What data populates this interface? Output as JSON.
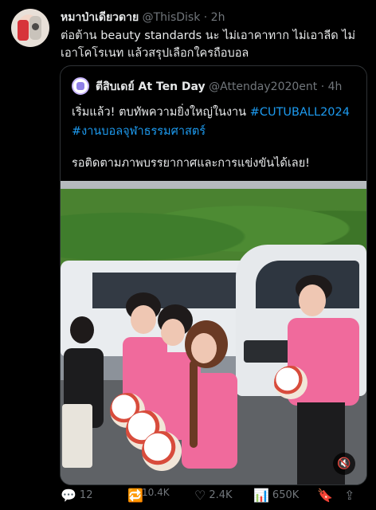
{
  "tweet": {
    "author_name": "หมาป่าเดียวดาย",
    "handle": "@ThisDisk",
    "separator": "·",
    "time": "2h",
    "text_line1": "ต่อต้าน beauty standards นะ ไม่เอาคาทาก ไม่เอาลีด ไม่",
    "text_line2": "เอาโคโรเนท แล้วสรุปเลือกใครถือบอล"
  },
  "quote": {
    "author_name": "ตีสิบเดย์ At Ten Day",
    "handle": "@Attenday2020ent",
    "separator": "·",
    "time": "4h",
    "line1_text": "เริ่มแล้ว! ตบทัพความยิ่งใหญ่ในงาน ",
    "line1_hashtag": "#CUTUBALL2024",
    "line2_hashtag": "#งานบอลจุฬาธรรมศาสตร์",
    "line3_text": "รอติดตามภาพบรรยากาศและการแข่งขันได้เลย!"
  },
  "media": {
    "mute_icon": "speaker-muted-icon",
    "mute_glyph": "🔇"
  },
  "actions": {
    "reply_icon": "reply-icon",
    "reply_glyph": "💬",
    "reply_count": "12",
    "retweet_icon": "retweet-icon",
    "retweet_glyph": "🔁",
    "retweet_count": "10.4K",
    "like_icon": "heart-icon",
    "like_glyph": "♡",
    "like_count": "2.4K",
    "views_icon": "views-icon",
    "views_glyph": "📊",
    "views_count": "650K",
    "bookmark_icon": "bookmark-icon",
    "bookmark_glyph": "🔖",
    "share_icon": "share-icon",
    "share_glyph": "⇪"
  },
  "colors": {
    "background": "#000000",
    "text": "#e7e9ea",
    "muted": "#71767b",
    "link": "#1d9bf0",
    "border": "#2f3336"
  }
}
